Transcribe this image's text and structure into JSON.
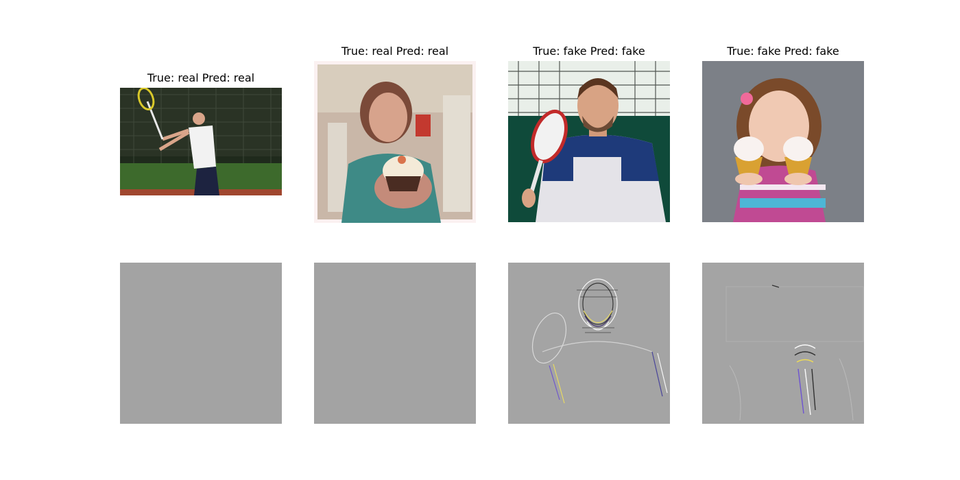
{
  "panels": [
    {
      "title": "True: real Pred: real",
      "image": "tennis player hitting forehand on clay court"
    },
    {
      "title": "True: real Pred: real",
      "image": "girl holding a cupcake (vintage-filtered photo)"
    },
    {
      "title": "True: fake Pred: fake",
      "image": "smiling man holding a tennis racket"
    },
    {
      "title": "True: fake Pred: fake",
      "image": "smiling girl holding two cupcakes"
    }
  ],
  "maps": [
    {
      "image": "uniform gray attribution map"
    },
    {
      "image": "uniform gray attribution map"
    },
    {
      "image": "gray attribution map with colorful high-frequency edges around face and racket"
    },
    {
      "image": "gray attribution map with colorful high-frequency edges around hands and cupcakes"
    }
  ],
  "colors": {
    "background": "#ffffff",
    "map_gray": "#a3a3a3",
    "text": "#000000"
  }
}
